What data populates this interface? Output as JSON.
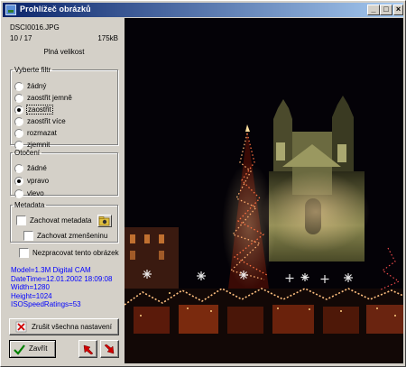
{
  "window": {
    "title": "Prohlížeč obrázků",
    "controls": {
      "minimize": "_",
      "maximize": "□",
      "close": "×"
    }
  },
  "file": {
    "name": "DSCI0016.JPG",
    "index": "10 / 17",
    "size": "175kB",
    "view_mode": "Plná velikost"
  },
  "filter": {
    "legend": "Vyberte filtr",
    "options": [
      "žádný",
      "zaostřit jemně",
      "zaostřit",
      "zaostřit více",
      "rozmazat",
      "zjemnit"
    ],
    "selected": "zaostřit"
  },
  "rotation": {
    "legend": "Otočení",
    "options": [
      "žádné",
      "vpravo",
      "vlevo"
    ],
    "selected": "vpravo"
  },
  "metadata": {
    "legend": "Metadata",
    "keep_metadata": "Zachovat metadata",
    "keep_thumbnail": "Zachovat zmenšeninu"
  },
  "skip_image": "Nezpracovat tento obrázek",
  "exif_lines": [
    "Model=1.3M Digital CAM",
    "DateTime=12.01.2002  18:09:08",
    "Width=1280",
    "Height=1024",
    "ISOSpeedRatings=53"
  ],
  "buttons": {
    "reset": "Zrušit všechna nastavení",
    "close": "Zavřít"
  },
  "colors": {
    "title_start": "#0a246a",
    "title_end": "#a6caf0",
    "exif_text": "#0000ff",
    "face": "#d4d0c8"
  },
  "icons": [
    "app-icon",
    "folder-camera-icon",
    "red-x-icon",
    "checkmark-icon",
    "arrow-prev-icon",
    "arrow-next-icon"
  ]
}
